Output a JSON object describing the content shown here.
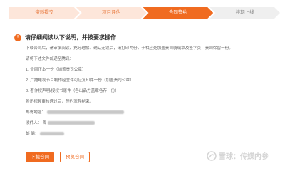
{
  "steps": [
    {
      "label": "资料提交",
      "state": "done"
    },
    {
      "label": "项目评估",
      "state": "done"
    },
    {
      "label": "合同签约",
      "state": "active"
    },
    {
      "label": "排期上线",
      "state": "todo"
    }
  ],
  "notice": {
    "icon": "!",
    "title": "请仔细阅读以下说明，并按要求操作"
  },
  "instructions": {
    "line1": "下载合同后，请审慎阅读、充分理解，确认无误后，请打印两份，于相应处加盖贵司骑缝章及签字页，贵司保留一份。",
    "line2": "请将下述文件邮递至腾讯：",
    "item1": "1. 合同正本一份（加盖贵司公章）",
    "item2": "2. 广播电视节目制作经营许可证复印件一份（加盖贵司公章）",
    "item3": "3. 著作权声明/授权书原件（各出品方盖章各存一份）",
    "line3": "腾讯视频审核通过后，签约流程结束。"
  },
  "mail": {
    "address_label": "邮寄地址：",
    "recipient_label": "收件人：",
    "recipient_prefix": "周",
    "postcode_label": "邮 编："
  },
  "buttons": {
    "download": "下载合同",
    "preview": "预览合同"
  },
  "watermark": {
    "text": "雪球：传媒内参"
  }
}
